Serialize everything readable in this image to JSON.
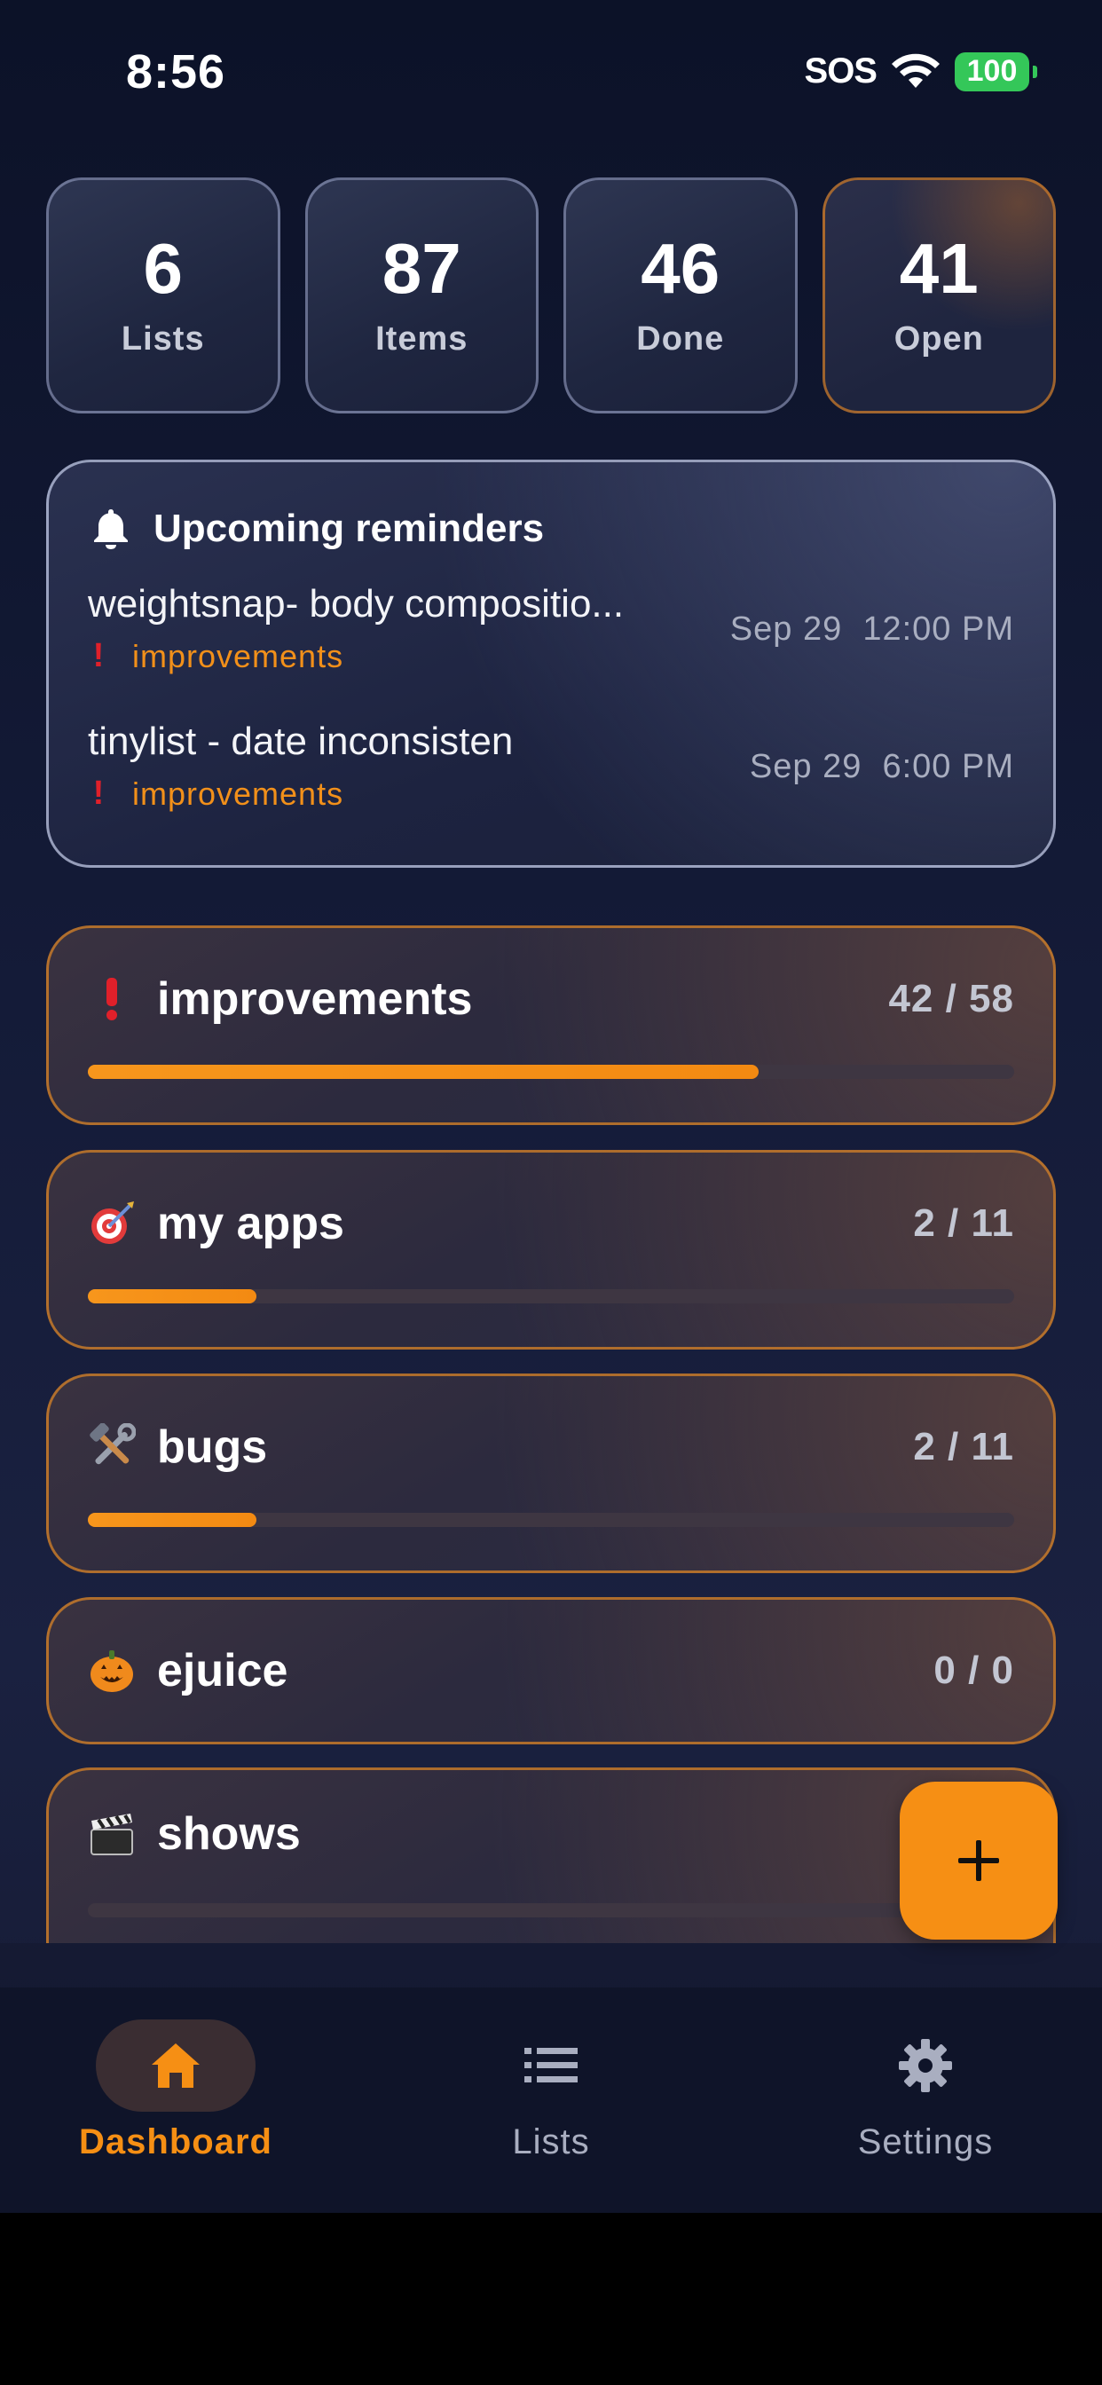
{
  "status_bar": {
    "time": "8:56",
    "sos": "SOS",
    "battery": "100"
  },
  "stats": [
    {
      "value": "6",
      "label": "Lists"
    },
    {
      "value": "87",
      "label": "Items"
    },
    {
      "value": "46",
      "label": "Done"
    },
    {
      "value": "41",
      "label": "Open"
    }
  ],
  "reminders": {
    "title": "Upcoming reminders",
    "items": [
      {
        "name": "weightsnap- body compositio...",
        "list": "improvements",
        "date": "Sep 29  12:00 PM"
      },
      {
        "name": "tinylist - date inconsisten",
        "list": "improvements",
        "date": "Sep 29  6:00 PM"
      }
    ]
  },
  "lists": [
    {
      "icon": "exclamation-icon",
      "name": "improvements",
      "count": "42 / 58",
      "progress": 0.724
    },
    {
      "icon": "dart-target-icon",
      "name": "my apps",
      "count": "2 / 11",
      "progress": 0.182
    },
    {
      "icon": "hammer-wrench-icon",
      "name": "bugs",
      "count": "2 / 11",
      "progress": 0.182
    },
    {
      "icon": "pumpkin-icon",
      "name": "ejuice",
      "count": "0 / 0",
      "progress": 0
    },
    {
      "icon": "clapperboard-icon",
      "name": "shows",
      "count": "",
      "progress": 0
    }
  ],
  "fab": {
    "icon": "plus-icon"
  },
  "tabbar": {
    "tabs": [
      {
        "icon": "home-icon",
        "label": "Dashboard",
        "active": true
      },
      {
        "icon": "list-icon",
        "label": "Lists",
        "active": false
      },
      {
        "icon": "gear-icon",
        "label": "Settings",
        "active": false
      }
    ]
  },
  "colors": {
    "accent": "#f68f14",
    "alert": "#e0202a",
    "background": "#141b38"
  }
}
